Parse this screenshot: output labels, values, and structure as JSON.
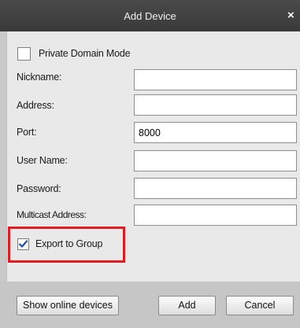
{
  "dialog": {
    "title": "Add Device",
    "close_glyph": "×"
  },
  "form": {
    "private_domain": {
      "label": "Private Domain Mode",
      "checked": false
    },
    "fields": [
      {
        "label": "Nickname:",
        "value": ""
      },
      {
        "label": "Address:",
        "value": ""
      },
      {
        "label": "Port:",
        "value": "8000"
      },
      {
        "label": "User Name:",
        "value": ""
      },
      {
        "label": "Password:",
        "value": ""
      },
      {
        "label": "Multicast Address:",
        "value": ""
      }
    ],
    "export_to_group": {
      "label": "Export to Group",
      "checked": true
    }
  },
  "footer": {
    "show_online_label": "Show online devices",
    "add_label": "Add",
    "cancel_label": "Cancel"
  },
  "colors": {
    "highlight": "#e11b22",
    "checkmark": "#1f4fa8",
    "titlebar": "#3f3f3f"
  }
}
